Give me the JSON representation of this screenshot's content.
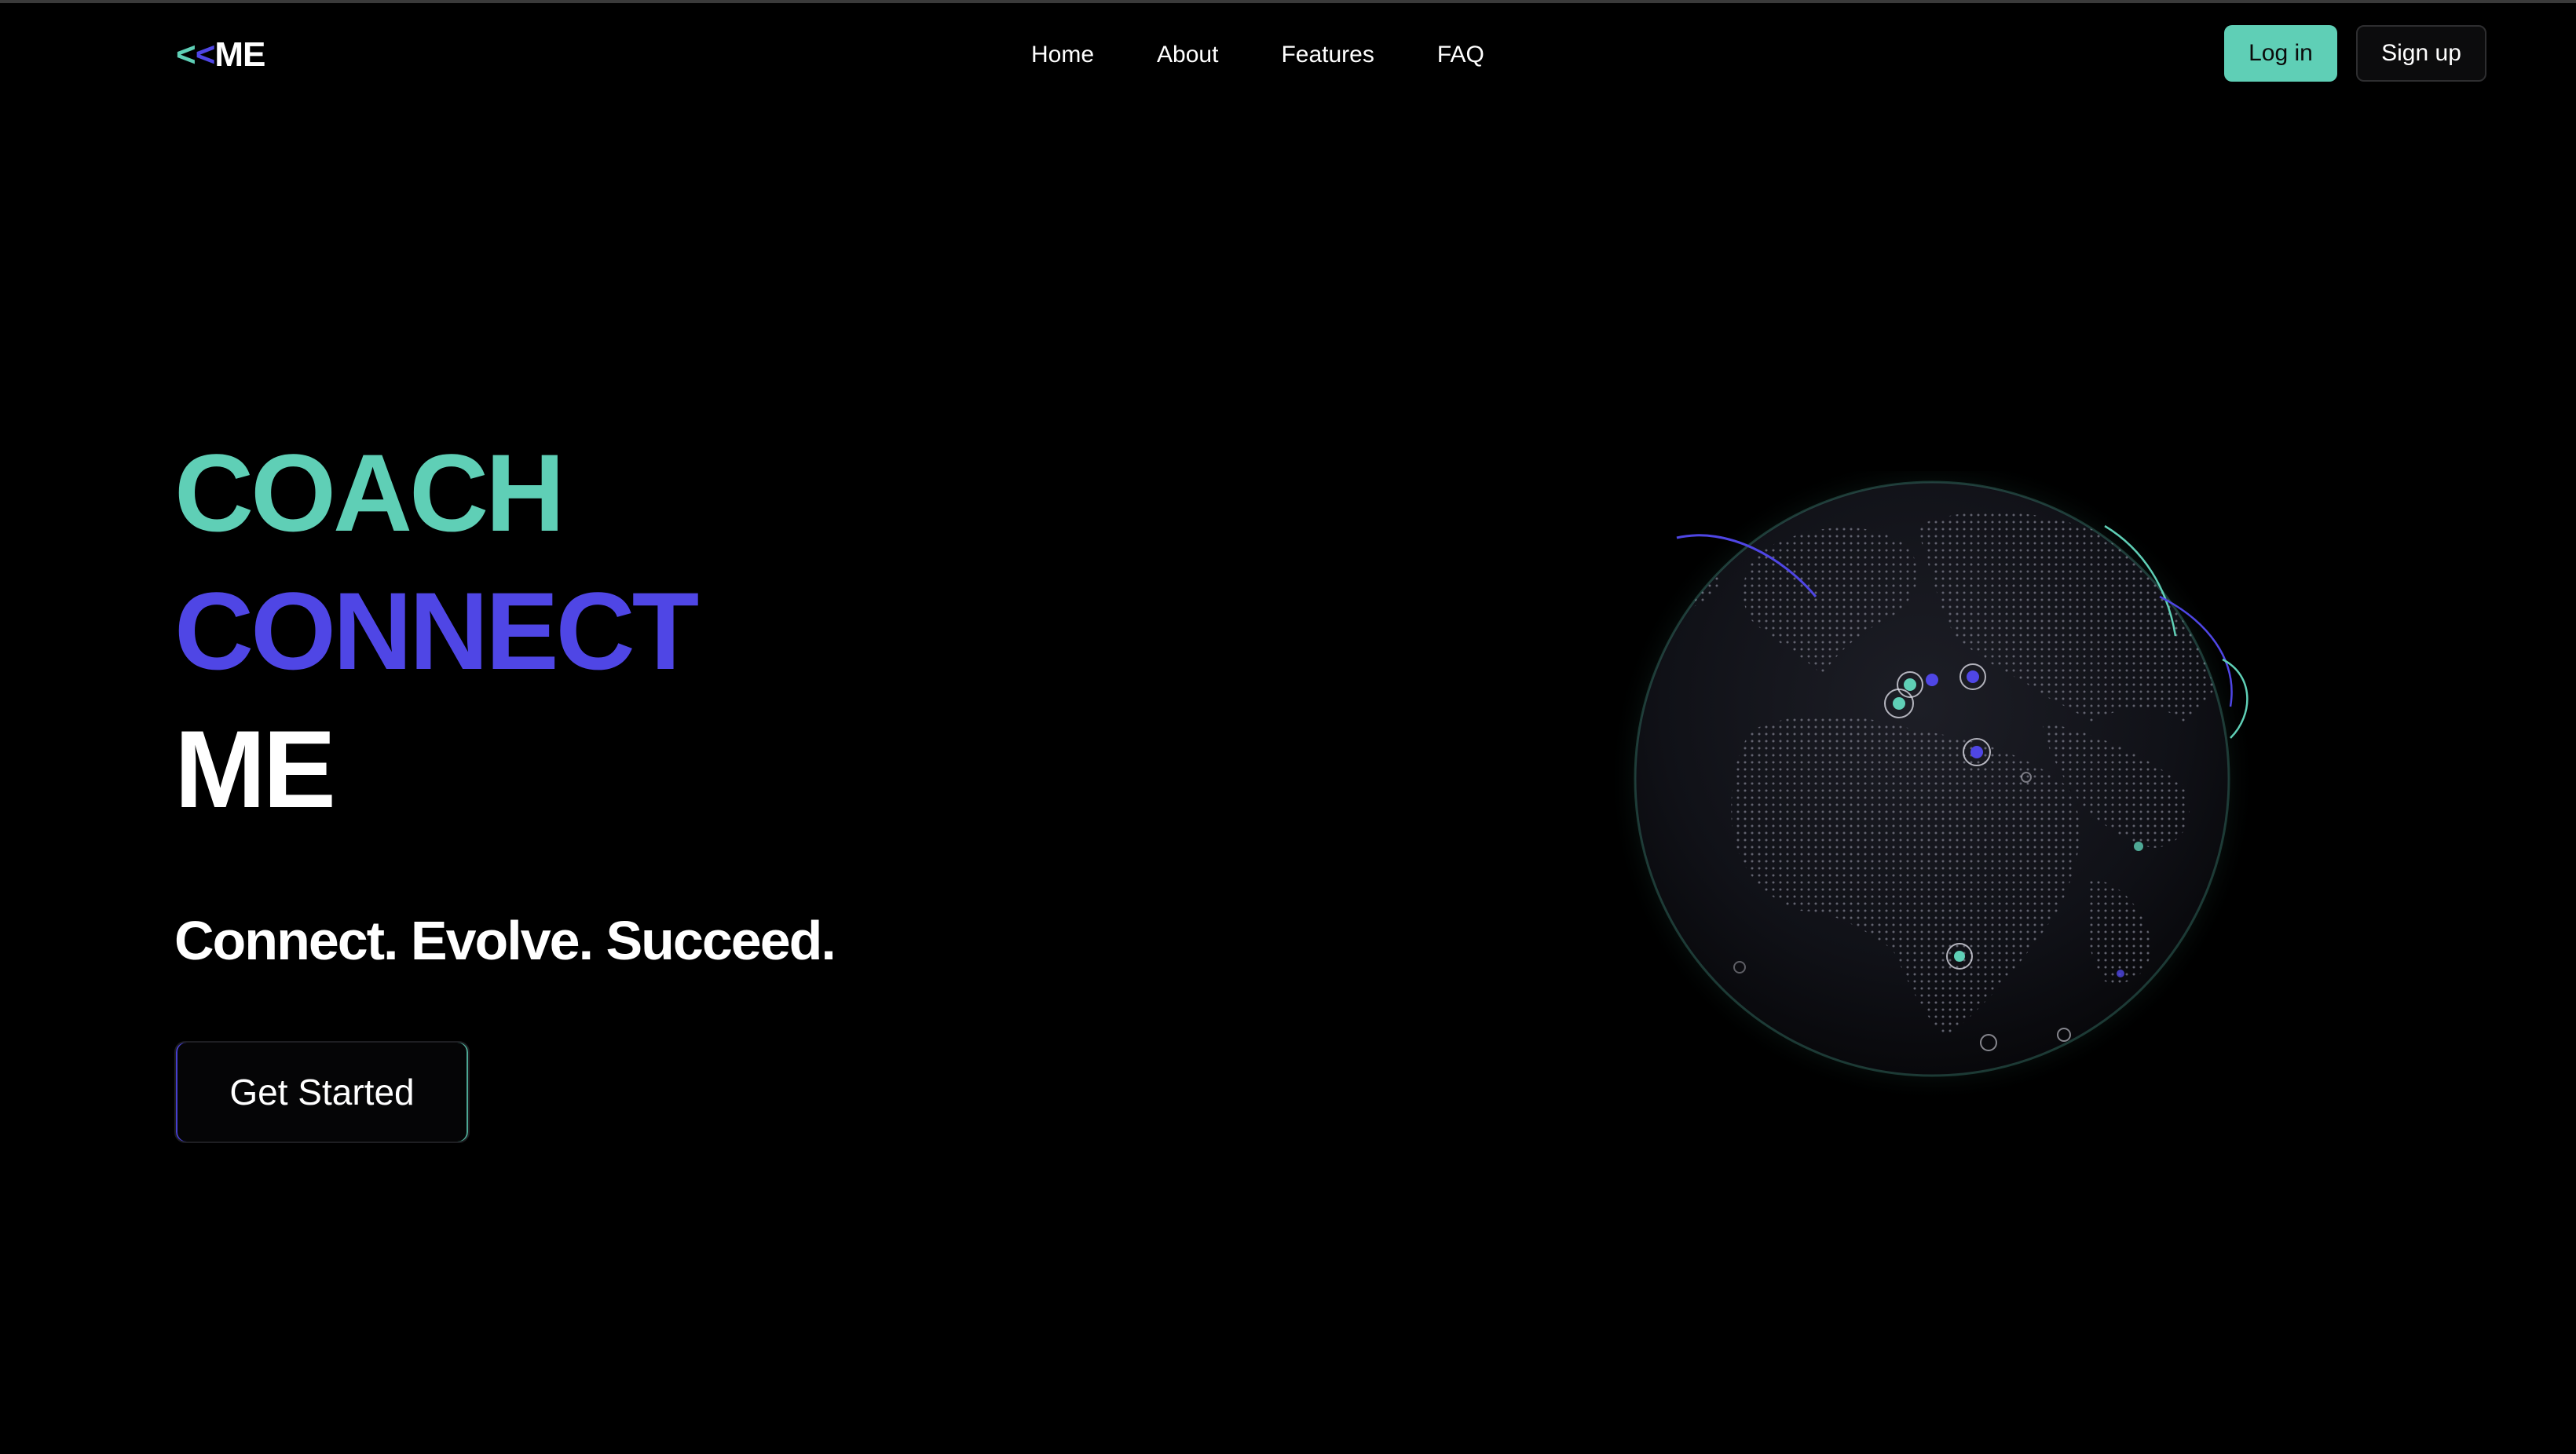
{
  "header": {
    "logo": {
      "part1": "<",
      "part2": "<",
      "part3": "ME"
    },
    "nav": {
      "home": "Home",
      "about": "About",
      "features": "Features",
      "faq": "FAQ"
    },
    "auth": {
      "login": "Log in",
      "signup": "Sign up"
    }
  },
  "hero": {
    "line1": "COACH",
    "line2": "CONNECT",
    "line3": "ME",
    "tagline": "Connect. Evolve. Succeed.",
    "cta": "Get Started"
  },
  "colors": {
    "background": "#000000",
    "accent_teal": "#5fcfb6",
    "accent_indigo": "#4f46e5",
    "text": "#ffffff"
  },
  "globe": {
    "icon": "globe-icon"
  }
}
